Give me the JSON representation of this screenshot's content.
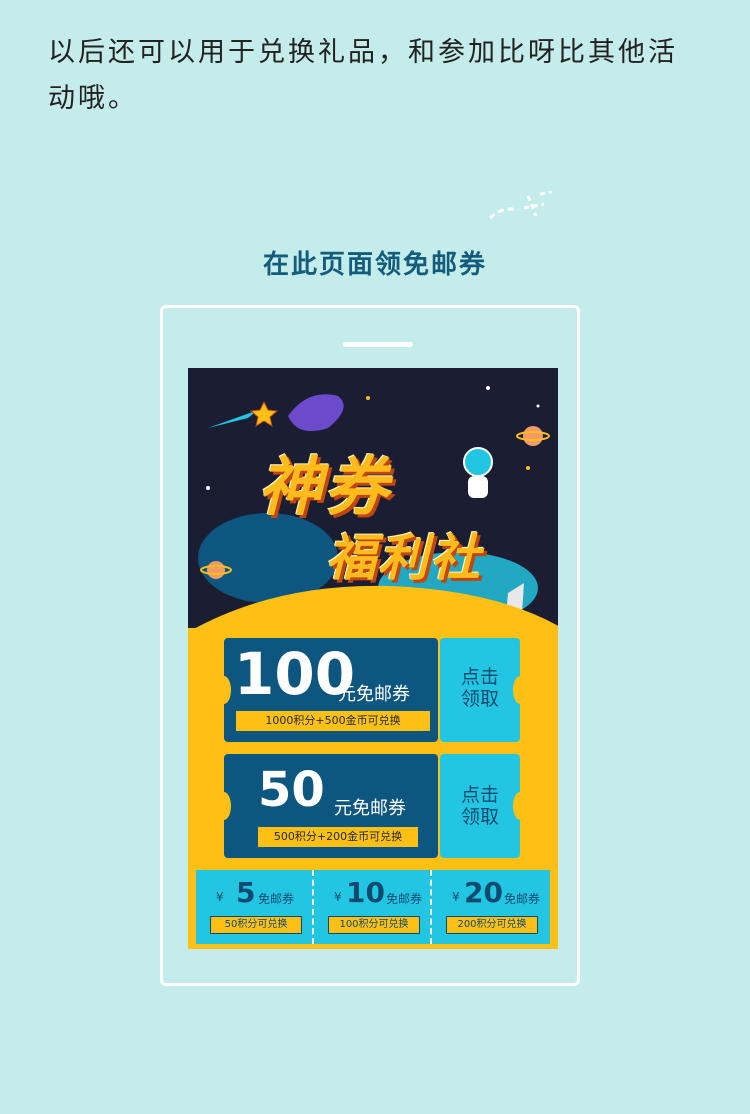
{
  "intro": {
    "line1": "以后还可以用于兑换礼品，和参加比呀比其他活",
    "line2": "动哦。"
  },
  "section_title": "在此页面领免邮券",
  "poster": {
    "title_line1": "神券",
    "title_line2": "福利社",
    "tickets": [
      {
        "amount": "100",
        "unit": "元免邮券",
        "condition": "1000积分+500金币可兑换",
        "claim_line1": "点击",
        "claim_line2": "领取"
      },
      {
        "amount": "50",
        "unit": "元免邮券",
        "condition": "500积分+200金币可兑换",
        "claim_line1": "点击",
        "claim_line2": "领取"
      }
    ],
    "mini_coupons": [
      {
        "currency": "¥",
        "amount": "5",
        "unit": "免邮券",
        "condition": "50积分可兑换"
      },
      {
        "currency": "¥",
        "amount": "10",
        "unit": "免邮券",
        "condition": "100积分可兑换"
      },
      {
        "currency": "¥",
        "amount": "20",
        "unit": "免邮券",
        "condition": "200积分可兑换"
      }
    ]
  },
  "colors": {
    "background": "#c4ecea",
    "accent_blue": "#0d5680",
    "accent_cyan": "#22c6e2",
    "accent_yellow": "#ffc015",
    "poster_dark": "#1b1d33"
  }
}
